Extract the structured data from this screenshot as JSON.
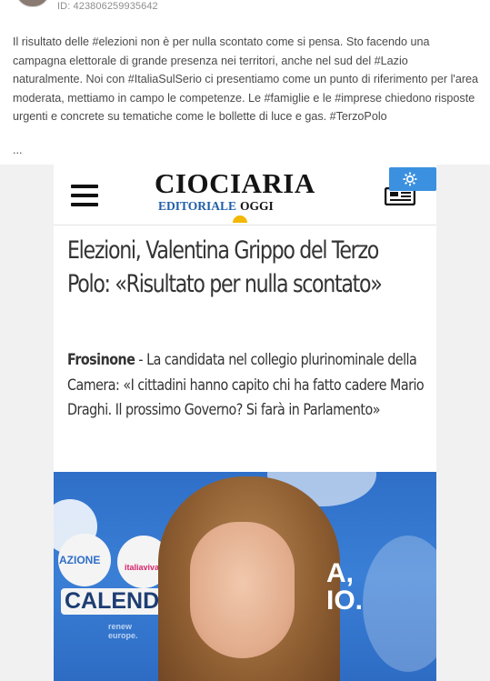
{
  "post": {
    "id_label": "ID: 423806259935642",
    "text": "Il risultato delle #elezioni non è per nulla scontato come si pensa. Sto facendo una campagna elettorale di grande presenza nei territori, anche nel sud del #Lazio naturalmente. Noi con #ItaliaSulSerio ci presentiamo come un punto di riferimento per l'area moderata, mettiamo in campo le competenze. Le #famiglie e le #imprese chiedono risposte urgenti e concrete su tematiche come le bollette di luce e gas. #TerzoPolo",
    "more": "..."
  },
  "article": {
    "logo_main": "CIOCIARIA",
    "logo_sub_1": "EDITORIALE",
    "logo_sub_2": "OGGI",
    "headline": "Elezioni, Valentina Grippo del Terzo Polo: «Risultato per nulla scontato»",
    "lead_place": "Frosinone",
    "lead_text": " - La candidata nel collegio plurinominale della Camera: «I cittadini hanno capito chi ha fatto cadere Mario Draghi. Il prossimo Governo? Si farà in Parlamento»"
  },
  "photo_texts": {
    "azione": "AZIONE",
    "italiaviva": "italiaviva",
    "calenda": "CALEND",
    "renew": "renew europe.",
    "right_a": "A,",
    "right_io": "IO."
  },
  "colors": {
    "accent_blue": "#3b91e0",
    "brand_blue": "#1f5ea8",
    "sun": "#f2b800"
  },
  "icons": {
    "menu": "hamburger-icon",
    "news": "newspaper-icon",
    "settings": "gear-icon"
  }
}
